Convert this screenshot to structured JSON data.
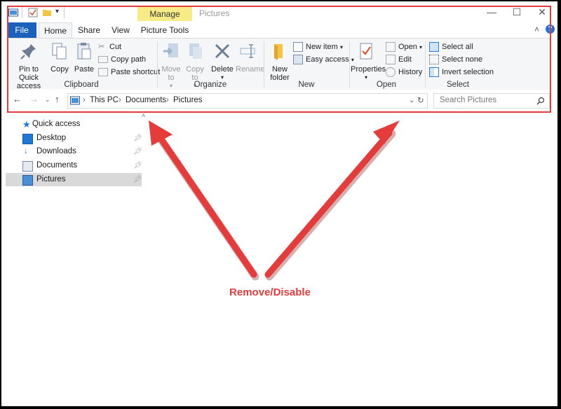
{
  "window": {
    "title": "Pictures",
    "contextual_tab": "Manage",
    "controls": {
      "minimize": "—",
      "maximize": "☐",
      "close": "✕"
    }
  },
  "tabs": {
    "file": "File",
    "home": "Home",
    "share": "Share",
    "view": "View",
    "picture_tools": "Picture Tools"
  },
  "ribbon": {
    "clipboard": {
      "label": "Clipboard",
      "pin_to_quick_access": "Pin to Quick access",
      "copy": "Copy",
      "paste": "Paste",
      "cut": "Cut",
      "copy_path": "Copy path",
      "paste_shortcut": "Paste shortcut"
    },
    "organize": {
      "label": "Organize",
      "move_to": "Move to",
      "copy_to": "Copy to",
      "delete": "Delete",
      "rename": "Rename"
    },
    "new": {
      "label": "New",
      "new_folder": "New folder",
      "new_item": "New item",
      "easy_access": "Easy access"
    },
    "open": {
      "label": "Open",
      "properties": "Properties",
      "open": "Open",
      "edit": "Edit",
      "history": "History"
    },
    "select": {
      "label": "Select",
      "select_all": "Select all",
      "select_none": "Select none",
      "invert_selection": "Invert selection"
    }
  },
  "address": {
    "breadcrumb": [
      "This PC",
      "Documents",
      "Pictures"
    ],
    "search_placeholder": "Search Pictures"
  },
  "nav_pane": {
    "quick_access": "Quick access",
    "items": [
      "Desktop",
      "Downloads",
      "Documents",
      "Pictures"
    ],
    "selected": "Pictures"
  },
  "annotation": {
    "text": "Remove/Disable",
    "color": "#e53b3b"
  },
  "colors": {
    "file_tab": "#1961ba",
    "manage_tab": "#f7eb86"
  }
}
